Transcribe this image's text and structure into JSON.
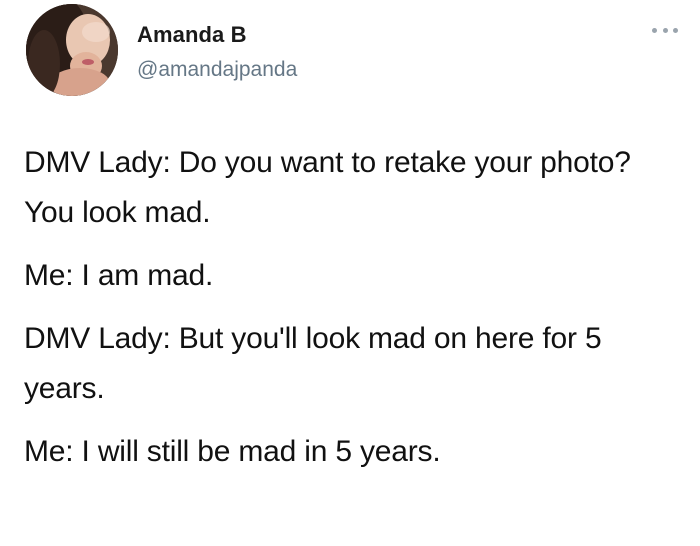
{
  "tweet": {
    "author": {
      "display_name": "Amanda B",
      "handle": "@amandajpanda",
      "avatar_icon": "profile-photo"
    },
    "menu_icon": "more-options-icon",
    "paragraphs": [
      "DMV Lady: Do you want to retake your photo? You look mad.",
      "Me: I am mad.",
      "DMV Lady: But you'll look mad on here for 5 years.",
      "Me: I will still be mad in 5 years."
    ]
  },
  "colors": {
    "background": "#ffffff",
    "text": "#111111",
    "handle": "#657786"
  }
}
